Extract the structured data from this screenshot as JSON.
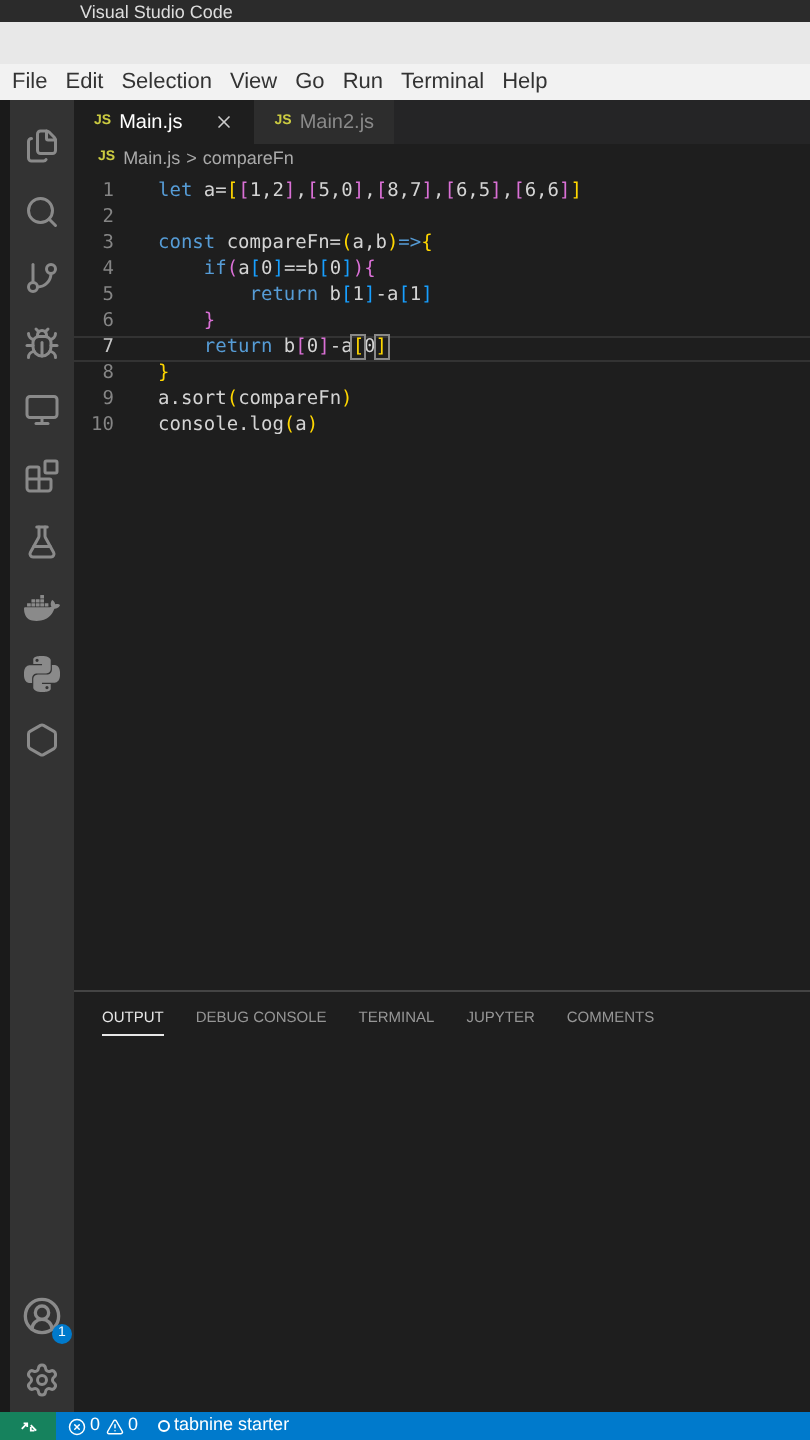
{
  "window": {
    "title": "Visual Studio Code"
  },
  "menu": [
    "File",
    "Edit",
    "Selection",
    "View",
    "Go",
    "Run",
    "Terminal",
    "Help"
  ],
  "tabs": [
    {
      "label": "Main.js",
      "badge": "JS",
      "selected": true
    },
    {
      "label": "Main2.js",
      "badge": "JS",
      "selected": false
    }
  ],
  "breadcrumb": {
    "badge": "JS",
    "file": "Main.js",
    "separator": ">",
    "symbol": "compareFn"
  },
  "editor": {
    "lines": [
      {
        "number": "1",
        "current": false,
        "tokens": [
          {
            "kind": "keyword",
            "text": "let "
          },
          {
            "kind": "plain",
            "text": "a="
          },
          {
            "kind": "b1",
            "text": "["
          },
          {
            "kind": "b2",
            "text": "["
          },
          {
            "kind": "plain",
            "text": "1,2"
          },
          {
            "kind": "b2",
            "text": "]"
          },
          {
            "kind": "plain",
            "text": ","
          },
          {
            "kind": "b2",
            "text": "["
          },
          {
            "kind": "plain",
            "text": "5,0"
          },
          {
            "kind": "b2",
            "text": "]"
          },
          {
            "kind": "plain",
            "text": ","
          },
          {
            "kind": "b2",
            "text": "["
          },
          {
            "kind": "plain",
            "text": "8,7"
          },
          {
            "kind": "b2",
            "text": "]"
          },
          {
            "kind": "plain",
            "text": ","
          },
          {
            "kind": "b2",
            "text": "["
          },
          {
            "kind": "plain",
            "text": "6,5"
          },
          {
            "kind": "b2",
            "text": "]"
          },
          {
            "kind": "plain",
            "text": ","
          },
          {
            "kind": "b2",
            "text": "["
          },
          {
            "kind": "plain",
            "text": "6,6"
          },
          {
            "kind": "b2",
            "text": "]"
          },
          {
            "kind": "b1",
            "text": "]"
          }
        ]
      },
      {
        "number": "2",
        "current": false
      },
      {
        "number": "3",
        "current": false,
        "tokens": [
          {
            "kind": "keyword",
            "text": "const "
          },
          {
            "kind": "plain",
            "text": "compareFn="
          },
          {
            "kind": "b1",
            "text": "("
          },
          {
            "kind": "plain",
            "text": "a,b"
          },
          {
            "kind": "b1",
            "text": ")"
          },
          {
            "kind": "keyword",
            "text": "=>"
          },
          {
            "kind": "b1",
            "text": "{"
          }
        ]
      },
      {
        "number": "4",
        "current": false,
        "tokens": [
          {
            "kind": "keyword",
            "text": "    if"
          },
          {
            "kind": "b2",
            "text": "("
          },
          {
            "kind": "plain",
            "text": "a"
          },
          {
            "kind": "b3",
            "text": "["
          },
          {
            "kind": "plain",
            "text": "0"
          },
          {
            "kind": "b3",
            "text": "]"
          },
          {
            "kind": "plain",
            "text": "==b"
          },
          {
            "kind": "b3",
            "text": "["
          },
          {
            "kind": "plain",
            "text": "0"
          },
          {
            "kind": "b3",
            "text": "]"
          },
          {
            "kind": "b2",
            "text": ")"
          },
          {
            "kind": "b2",
            "text": "{"
          }
        ]
      },
      {
        "number": "5",
        "current": false,
        "tokens": [
          {
            "kind": "keyword",
            "text": "        return "
          },
          {
            "kind": "plain",
            "text": "b"
          },
          {
            "kind": "b3",
            "text": "["
          },
          {
            "kind": "plain",
            "text": "1"
          },
          {
            "kind": "b3",
            "text": "]"
          },
          {
            "kind": "plain",
            "text": "-a"
          },
          {
            "kind": "b3",
            "text": "["
          },
          {
            "kind": "plain",
            "text": "1"
          },
          {
            "kind": "b3",
            "text": "]"
          }
        ]
      },
      {
        "number": "6",
        "current": false,
        "tokens": [
          {
            "kind": "b2",
            "text": "    }"
          }
        ]
      },
      {
        "number": "7",
        "current": true,
        "tokens": [
          {
            "kind": "keyword",
            "text": "    return "
          },
          {
            "kind": "plain",
            "text": "b"
          },
          {
            "kind": "b2",
            "text": "["
          },
          {
            "kind": "plain",
            "text": "0"
          },
          {
            "kind": "b2",
            "text": "]"
          },
          {
            "kind": "plain",
            "text": "-a"
          },
          {
            "kind": "match",
            "text": "["
          },
          {
            "kind": "plain",
            "text": "0"
          },
          {
            "kind": "match",
            "text": "]"
          }
        ]
      },
      {
        "number": "8",
        "current": false,
        "tokens": [
          {
            "kind": "b1",
            "text": "}"
          }
        ]
      },
      {
        "number": "9",
        "current": false,
        "tokens": [
          {
            "kind": "plain",
            "text": "a.sort"
          },
          {
            "kind": "b1",
            "text": "("
          },
          {
            "kind": "plain",
            "text": "compareFn"
          },
          {
            "kind": "b1",
            "text": ")"
          }
        ]
      },
      {
        "number": "10",
        "current": false,
        "tokens": [
          {
            "kind": "plain",
            "text": "console.log"
          },
          {
            "kind": "b1",
            "text": "("
          },
          {
            "kind": "plain",
            "text": "a"
          },
          {
            "kind": "b1",
            "text": ")"
          }
        ]
      }
    ]
  },
  "panel": {
    "tabs": [
      {
        "label": "OUTPUT",
        "selected": true
      },
      {
        "label": "DEBUG CONSOLE",
        "selected": false
      },
      {
        "label": "TERMINAL",
        "selected": false
      },
      {
        "label": "JUPYTER",
        "selected": false
      },
      {
        "label": "COMMENTS",
        "selected": false
      }
    ]
  },
  "activity_bar": {
    "account_badge": "1"
  },
  "status_bar": {
    "errors": "0",
    "warnings": "0",
    "extension": "tabnine starter"
  }
}
